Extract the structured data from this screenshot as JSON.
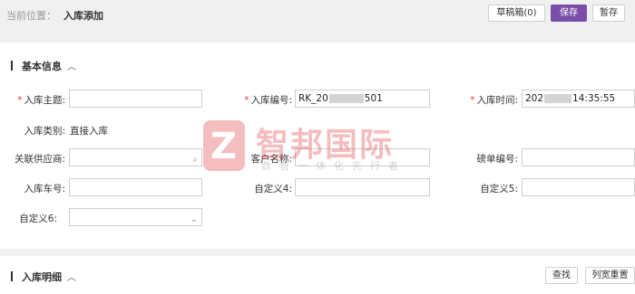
{
  "breadcrumb": {
    "label": "当前位置：",
    "current": "入库添加"
  },
  "toolbar": {
    "draft_label": "草稿箱(0)",
    "save_label": "保存",
    "hold_label": "暂存"
  },
  "section_basic": {
    "title": "基本信息"
  },
  "section_detail": {
    "title": "入库明细",
    "search_label": "查找",
    "reset_width_label": "列宽重置"
  },
  "form": {
    "subject": {
      "label": "入库主题:",
      "value": ""
    },
    "number": {
      "label": "入库编号:",
      "value_prefix": "RK_20",
      "value_suffix": "501"
    },
    "time": {
      "label": "入库时间:",
      "value_prefix": "202",
      "value_suffix": "14:35:55"
    },
    "type": {
      "label": "入库类别:",
      "value": "直接入库"
    },
    "supplier": {
      "label": "关联供应商:",
      "value": ""
    },
    "customer": {
      "label": "客户名称:",
      "value": ""
    },
    "weigh_no": {
      "label": "磅单编号:",
      "value": ""
    },
    "vehicle": {
      "label": "入库车号:",
      "value": ""
    },
    "custom4": {
      "label": "自定义4:",
      "value": ""
    },
    "custom5": {
      "label": "自定义5:",
      "value": ""
    },
    "custom6": {
      "label": "自定义6:",
      "value": ""
    }
  },
  "watermark": {
    "logo_letter": "Z",
    "title": "智邦国际",
    "subtitle": "数智一体化先行者"
  },
  "colors": {
    "accent": "#7a4ea8",
    "required": "#e23c3c"
  }
}
